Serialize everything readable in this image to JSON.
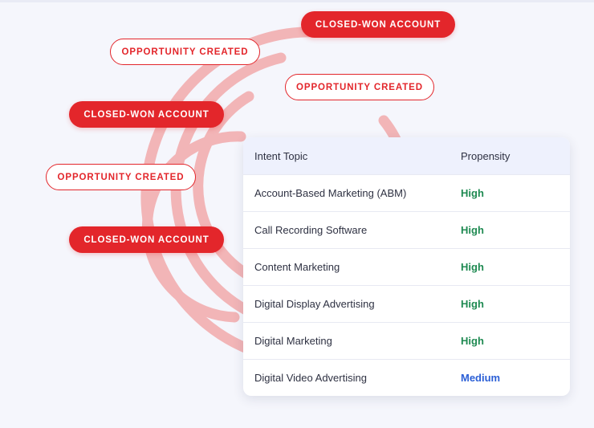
{
  "colors": {
    "brand_red": "#e3262b",
    "ring_pink": "#f2b5b7",
    "high_green": "#1f8a52",
    "medium_blue": "#2b5fd6",
    "header_bg": "#eef1fd"
  },
  "pills": [
    {
      "label": "CLOSED-WON ACCOUNT",
      "style": "filled"
    },
    {
      "label": "OPPORTUNITY CREATED",
      "style": "outline"
    },
    {
      "label": "OPPORTUNITY CREATED",
      "style": "outline"
    },
    {
      "label": "CLOSED-WON ACCOUNT",
      "style": "filled"
    },
    {
      "label": "OPPORTUNITY CREATED",
      "style": "outline"
    },
    {
      "label": "CLOSED-WON ACCOUNT",
      "style": "filled"
    }
  ],
  "table": {
    "headers": {
      "topic": "Intent Topic",
      "propensity": "Propensity"
    },
    "rows": [
      {
        "topic": "Account-Based Marketing (ABM)",
        "propensity": "High",
        "level": "high"
      },
      {
        "topic": "Call Recording Software",
        "propensity": "High",
        "level": "high"
      },
      {
        "topic": "Content Marketing",
        "propensity": "High",
        "level": "high"
      },
      {
        "topic": "Digital Display Advertising",
        "propensity": "High",
        "level": "high"
      },
      {
        "topic": "Digital Marketing",
        "propensity": "High",
        "level": "high"
      },
      {
        "topic": "Digital Video Advertising",
        "propensity": "Medium",
        "level": "medium"
      }
    ]
  }
}
